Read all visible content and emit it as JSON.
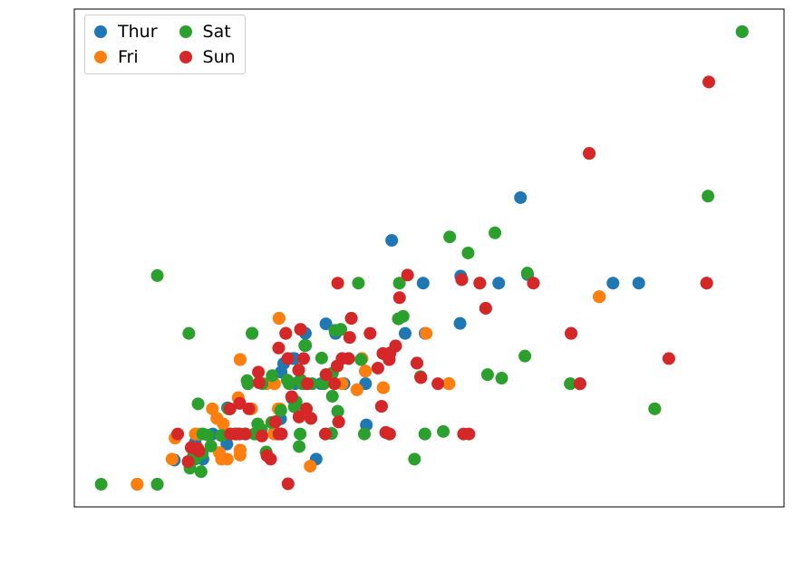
{
  "chart_data": {
    "type": "scatter",
    "title": "",
    "xlabel": "",
    "ylabel": "",
    "xlim": [
      1.07,
      53.93
    ],
    "ylim": [
      0.55,
      10.45
    ],
    "legend_entries": [
      "Thur",
      "Fri",
      "Sat",
      "Sun"
    ],
    "colors": {
      "Thur": "#1f77b4",
      "Fri": "#ff7f0e",
      "Sat": "#2ca02c",
      "Sun": "#d62728"
    },
    "series": [
      {
        "name": "Thur",
        "x": [
          27.2,
          22.76,
          17.29,
          19.44,
          16.66,
          10.07,
          32.68,
          15.98,
          34.83,
          13.03,
          18.28,
          24.71,
          21.16,
          28.97,
          22.49,
          5.75,
          16.32,
          22.75,
          40.17,
          27.05,
          20.69,
          13.13,
          17.26,
          24.55,
          19.77,
          29.85,
          48.17,
          25.0,
          13.39,
          16.49,
          21.5,
          12.66,
          16.21,
          13.81,
          17.51,
          24.52,
          20.76,
          31.71,
          10.59,
          10.63,
          50.81,
          15.36,
          20.49,
          25.21,
          18.24,
          14.31,
          14.0,
          7.25,
          38.07,
          23.95,
          25.71,
          17.31,
          29.93,
          10.65,
          12.43,
          24.27,
          11.69,
          13.42,
          14.26,
          15.95,
          12.48,
          29.8,
          8.52,
          14.52,
          11.38,
          22.82,
          19.08,
          20.53,
          16.47,
          26.59,
          38.73,
          24.08,
          16.43,
          18.29,
          17.47,
          34.3,
          41.19,
          27.18,
          19.81,
          43.11
        ],
        "y": [
          4.0,
          3.0,
          2.71,
          3.0,
          3.4,
          1.83,
          5.0,
          2.03,
          5.17,
          2.0,
          4.0,
          5.85,
          3.0,
          3.0,
          3.5,
          1.0,
          4.3,
          3.25,
          4.73,
          5.0,
          2.45,
          2.0,
          2.74,
          2.0,
          2.0,
          5.14,
          5.0,
          3.75,
          2.61,
          2.0,
          3.5,
          2.5,
          2.0,
          2.0,
          3.0,
          3.48,
          2.24,
          4.5,
          1.61,
          2.0,
          10.0,
          1.64,
          4.06,
          4.29,
          3.76,
          4.0,
          3.0,
          1.0,
          4.0,
          2.55,
          4.0,
          3.5,
          5.07,
          1.5,
          1.8,
          2.03,
          2.31,
          1.68,
          2.5,
          2.0,
          2.52,
          4.2,
          1.48,
          2.0,
          2.0,
          2.18,
          1.5,
          4.0,
          3.23,
          3.41,
          3.0,
          2.92,
          2.3,
          3.76,
          3.5,
          6.7,
          5.0,
          2.0,
          4.19,
          5.0
        ]
      },
      {
        "name": "Fri",
        "x": [
          28.97,
          22.49,
          5.75,
          16.32,
          22.75,
          40.17,
          27.28,
          12.03,
          21.01,
          12.46,
          11.35,
          15.38,
          44.3,
          22.42,
          20.92,
          15.98,
          13.42,
          16.27,
          10.09,
          8.58,
          13.42,
          16.4,
          20.45,
          13.28,
          22.12,
          24.08,
          11.69,
          13.42,
          14.26,
          15.95,
          8.35,
          18.64,
          11.87,
          9.78,
          28.97,
          22.49,
          5.75,
          16.32,
          22.75,
          40.17,
          12.16,
          13.42,
          8.58,
          15.98,
          13.42,
          16.27,
          10.09,
          20.45,
          13.28,
          22.12,
          24.08,
          15.04,
          10.34,
          13.0
        ],
        "y": [
          3.0,
          3.5,
          1.0,
          4.3,
          3.25,
          4.73,
          4.0,
          1.5,
          3.0,
          1.5,
          2.5,
          3.0,
          2.5,
          3.48,
          4.08,
          3.0,
          3.48,
          2.5,
          2.0,
          1.92,
          1.58,
          2.5,
          3.0,
          2.72,
          2.88,
          2.92,
          2.31,
          1.68,
          2.5,
          2.0,
          1.5,
          1.36,
          1.63,
          1.73,
          3.0,
          3.5,
          1.0,
          4.3,
          3.25,
          4.73,
          2.2,
          3.48,
          1.92,
          3.0,
          3.48,
          2.5,
          2.0,
          3.0,
          2.72,
          2.88,
          2.92,
          1.96,
          2.0,
          2.0
        ]
      },
      {
        "name": "Sat",
        "x": [
          20.65,
          17.92,
          20.29,
          15.77,
          39.42,
          19.82,
          17.81,
          13.37,
          12.69,
          21.7,
          19.65,
          9.55,
          18.35,
          15.06,
          20.69,
          17.78,
          24.06,
          16.31,
          16.93,
          18.69,
          31.27,
          16.04,
          17.46,
          13.94,
          9.68,
          30.4,
          18.29,
          22.23,
          32.4,
          28.55,
          18.04,
          12.54,
          10.29,
          34.81,
          9.94,
          25.56,
          19.49,
          38.01,
          26.41,
          11.24,
          48.27,
          20.29,
          13.81,
          11.02,
          18.29,
          17.59,
          20.08,
          16.45,
          3.07,
          20.23,
          15.01,
          12.02,
          17.07,
          26.86,
          25.28,
          14.73,
          10.51,
          17.92,
          44.3,
          22.42,
          20.92,
          10.07,
          15.36,
          20.49,
          25.21,
          18.24,
          14.31,
          14.0,
          7.25,
          10.59,
          10.63,
          50.81,
          15.81,
          7.25,
          31.85,
          16.82,
          32.9,
          17.89,
          14.48,
          9.6,
          34.63,
          29.03,
          27.18,
          22.67,
          17.82,
          18.78
        ],
        "y": [
          3.35,
          4.08,
          2.75,
          2.23,
          7.58,
          3.18,
          2.34,
          2.0,
          2.0,
          4.3,
          3.0,
          1.45,
          2.5,
          3.0,
          2.45,
          3.27,
          3.6,
          2.0,
          3.07,
          2.31,
          5.0,
          2.24,
          2.54,
          3.06,
          1.32,
          5.6,
          3.0,
          5.0,
          6.0,
          2.05,
          3.0,
          2.5,
          2.6,
          5.2,
          1.56,
          4.34,
          3.51,
          3.0,
          1.5,
          1.76,
          6.73,
          3.21,
          2.0,
          1.98,
          3.76,
          2.64,
          3.15,
          2.47,
          1.0,
          2.01,
          2.09,
          1.97,
          3.0,
          3.14,
          5.0,
          2.2,
          1.25,
          3.08,
          2.5,
          3.48,
          4.08,
          1.5,
          1.64,
          4.06,
          4.29,
          3.76,
          4.0,
          3.0,
          5.15,
          1.61,
          2.0,
          10.0,
          3.16,
          1.0,
          3.18,
          4.0,
          3.11,
          2.0,
          2.0,
          4.0,
          3.55,
          5.92,
          2.0,
          2.0,
          1.75,
          3.0
        ]
      },
      {
        "name": "Sun",
        "x": [
          16.99,
          10.34,
          21.01,
          23.68,
          24.59,
          25.29,
          8.77,
          26.88,
          15.04,
          14.78,
          10.27,
          35.26,
          15.42,
          18.43,
          14.83,
          21.58,
          10.33,
          16.29,
          16.97,
          20.65,
          17.92,
          39.42,
          19.82,
          17.81,
          13.37,
          12.69,
          21.7,
          9.55,
          18.35,
          17.78,
          24.06,
          16.31,
          18.69,
          31.27,
          16.04,
          38.07,
          23.95,
          29.93,
          14.07,
          13.13,
          17.26,
          24.55,
          19.77,
          48.17,
          16.49,
          21.5,
          12.66,
          13.81,
          24.52,
          20.76,
          31.71,
          20.69,
          30.46,
          18.15,
          23.1,
          15.69,
          26.59,
          38.73,
          24.27,
          30.06,
          25.89,
          48.33,
          9.78,
          45.35,
          16.82,
          28.15,
          13.39,
          20.45,
          25.0
        ],
        "y": [
          1.01,
          1.66,
          3.5,
          3.31,
          3.61,
          4.71,
          2.0,
          3.12,
          1.96,
          3.23,
          1.71,
          5.0,
          1.57,
          3.0,
          3.02,
          3.92,
          1.67,
          3.71,
          3.5,
          3.35,
          4.08,
          7.58,
          3.18,
          2.34,
          2.0,
          2.0,
          4.3,
          1.45,
          2.5,
          3.27,
          3.6,
          2.0,
          2.31,
          5.0,
          2.24,
          4.0,
          2.55,
          5.07,
          2.5,
          2.0,
          2.74,
          2.0,
          2.0,
          5.0,
          2.0,
          3.5,
          2.5,
          2.0,
          3.48,
          2.24,
          4.5,
          5.0,
          2.0,
          3.5,
          4.0,
          1.5,
          3.41,
          3.0,
          2.03,
          2.0,
          5.16,
          9.0,
          1.73,
          3.5,
          4.0,
          3.0,
          2.61,
          3.0,
          3.75
        ]
      }
    ]
  },
  "legend": {
    "items": [
      {
        "label": "Thur"
      },
      {
        "label": "Fri"
      },
      {
        "label": "Sat"
      },
      {
        "label": "Sun"
      }
    ]
  }
}
